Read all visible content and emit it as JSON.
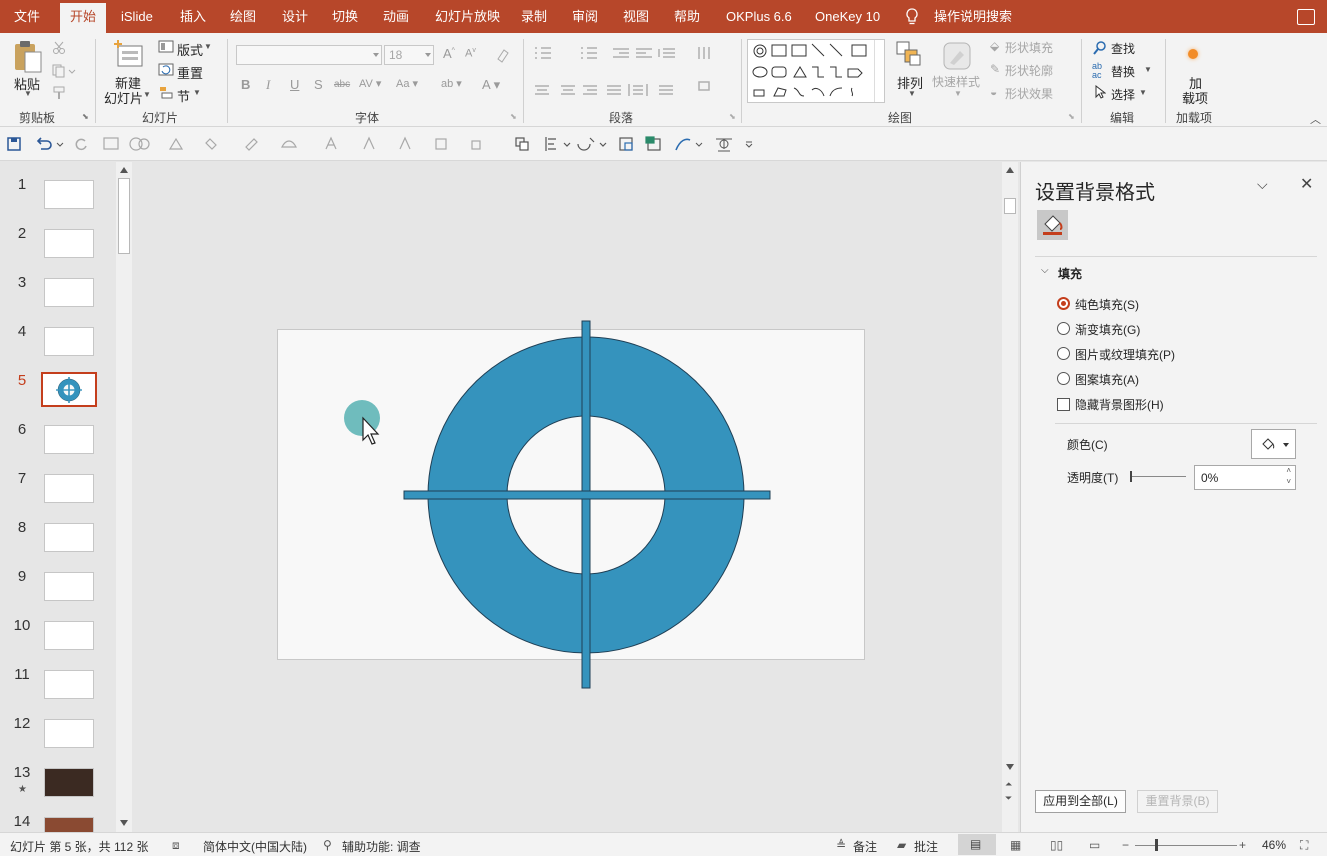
{
  "menu": {
    "tabs": [
      "文件",
      "开始",
      "iSlide",
      "插入",
      "绘图",
      "设计",
      "切换",
      "动画",
      "幻灯片放映",
      "录制",
      "审阅",
      "视图",
      "帮助",
      "OKPlus 6.6",
      "OneKey 10"
    ],
    "active": "开始",
    "search": "操作说明搜索"
  },
  "ribbon": {
    "clipboard": {
      "paste": "粘贴",
      "group": "剪贴板"
    },
    "slides": {
      "new_slide": "新建",
      "new_slide2": "幻灯片",
      "layout": "版式",
      "reset": "重置",
      "section": "节",
      "group": "幻灯片"
    },
    "font": {
      "size": "18",
      "group": "字体"
    },
    "paragraph": {
      "group": "段落"
    },
    "drawing": {
      "arrange": "排列",
      "quick_styles": "快速样式",
      "shape_fill": "形状填充",
      "shape_outline": "形状轮廓",
      "shape_effects": "形状效果",
      "group": "绘图"
    },
    "editing": {
      "find": "查找",
      "replace": "替换",
      "select": "选择",
      "group": "编辑"
    },
    "addins": {
      "label1": "加",
      "label2": "载项",
      "group": "加载项"
    }
  },
  "thumbnails": {
    "numbers": [
      "1",
      "2",
      "3",
      "4",
      "5",
      "6",
      "7",
      "8",
      "9",
      "10",
      "11",
      "12",
      "13",
      "14"
    ],
    "selected": "5"
  },
  "pane": {
    "title": "设置背景格式",
    "section": "填充",
    "options": [
      "纯色填充(S)",
      "渐变填充(G)",
      "图片或纹理填充(P)",
      "图案填充(A)"
    ],
    "hide_bg": "隐藏背景图形(H)",
    "color_label": "颜色(C)",
    "transparency_label": "透明度(T)",
    "transparency_value": "0%",
    "apply_all": "应用到全部(L)",
    "reset_bg": "重置背景(B)"
  },
  "status": {
    "slide_info": "幻灯片 第 5 张，共 112 张",
    "language": "简体中文(中国大陆)",
    "accessibility": "辅助功能: 调查",
    "notes": "备注",
    "comments": "批注",
    "zoom": "46%"
  },
  "colors": {
    "accent": "#b7472a",
    "ring": "#3593bd",
    "cursor_dot": "#5fb5b6"
  }
}
